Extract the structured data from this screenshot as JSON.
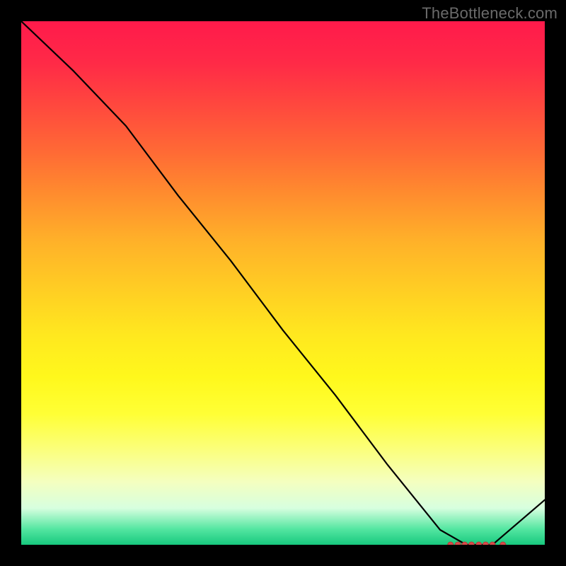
{
  "watermark": "TheBottleneck.com",
  "colors": {
    "background": "#000000",
    "curve": "#000000",
    "marker_fill": "#d94a4a",
    "marker_stroke": "#b33a3a"
  },
  "chart_data": {
    "type": "line",
    "title": "",
    "xlabel": "",
    "ylabel": "",
    "xlim": [
      0,
      100
    ],
    "ylim": [
      0,
      105
    ],
    "grid": false,
    "legend": false,
    "x": [
      0,
      10,
      20,
      30,
      40,
      50,
      60,
      70,
      80,
      85,
      90,
      100
    ],
    "values": [
      105,
      95,
      84,
      70,
      57,
      43,
      30,
      16,
      3,
      0,
      0,
      9
    ],
    "flat_min_range_x": [
      82,
      92
    ],
    "y_colormap_stops": [
      {
        "y": 0,
        "color": "#17c97e"
      },
      {
        "y": 8,
        "color": "#d7ffdf"
      },
      {
        "y": 25,
        "color": "#fff81c"
      },
      {
        "y": 50,
        "color": "#ffb129"
      },
      {
        "y": 75,
        "color": "#ff6a35"
      },
      {
        "y": 100,
        "color": "#ff1a4b"
      }
    ],
    "markers": {
      "y": 0,
      "x_positions": [
        82.0,
        83.4,
        84.7,
        86.0,
        87.4,
        88.7,
        90.0,
        92.0
      ],
      "shape": "circle",
      "radius_px": 4
    }
  }
}
